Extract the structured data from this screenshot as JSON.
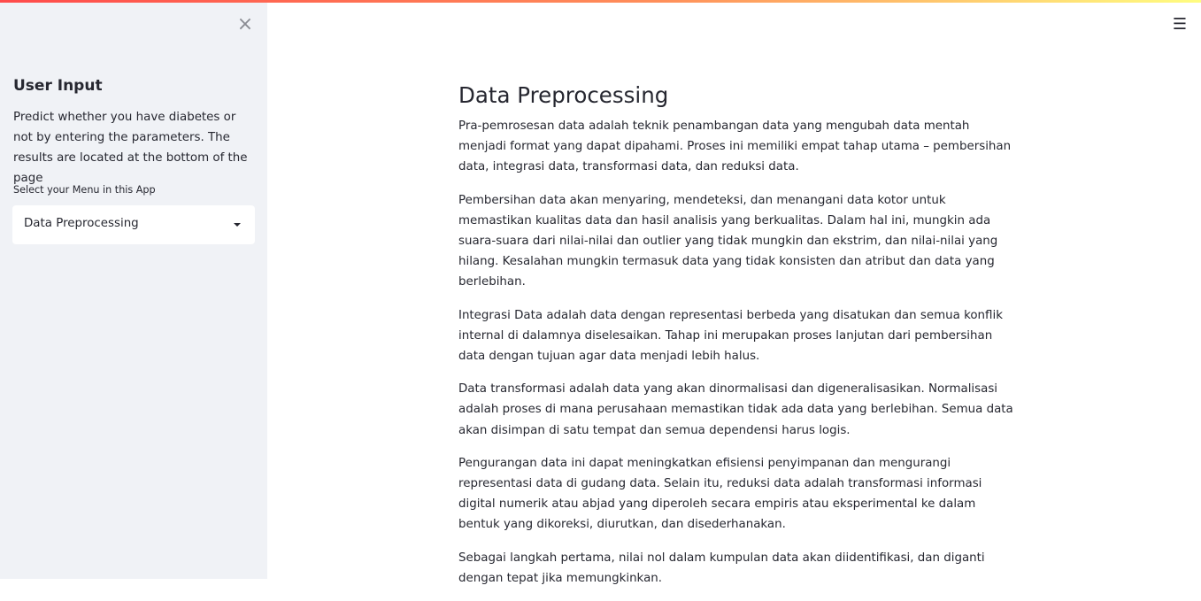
{
  "sidebar": {
    "close_icon": "×",
    "title": "User Input",
    "description": "Predict whether you have diabetes or not by entering the parameters. The results are located at the bottom of the page",
    "select_label": "Select your Menu in this App",
    "select_value": "Data Preprocessing"
  },
  "header": {
    "menu_icon": "☰"
  },
  "main": {
    "title": "Data Preprocessing",
    "paragraphs": [
      "Pra-pemrosesan data adalah teknik penambangan data yang mengubah data mentah menjadi format yang dapat dipahami. Proses ini memiliki empat tahap utama – pembersihan data, integrasi data, transformasi data, dan reduksi data.",
      "Pembersihan data akan menyaring, mendeteksi, dan menangani data kotor untuk memastikan kualitas data dan hasil analisis yang berkualitas. Dalam hal ini, mungkin ada suara-suara dari nilai-nilai dan outlier yang tidak mungkin dan ekstrim, dan nilai-nilai yang hilang. Kesalahan mungkin termasuk data yang tidak konsisten dan atribut dan data yang berlebihan.",
      "Integrasi Data adalah data dengan representasi berbeda yang disatukan dan semua konflik internal di dalamnya diselesaikan. Tahap ini merupakan proses lanjutan dari pembersihan data dengan tujuan agar data menjadi lebih halus.",
      "Data transformasi adalah data yang akan dinormalisasi dan digeneralisasikan. Normalisasi adalah proses di mana perusahaan memastikan tidak ada data yang berlebihan. Semua data akan disimpan di satu tempat dan semua dependensi harus logis.",
      "Pengurangan data ini dapat meningkatkan efisiensi penyimpanan dan mengurangi representasi data di gudang data. Selain itu, reduksi data adalah transformasi informasi digital numerik atau abjad yang diperoleh secara empiris atau eksperimental ke dalam bentuk yang dikoreksi, diurutkan, dan disederhanakan.",
      "Sebagai langkah pertama, nilai nol dalam kumpulan data akan diidentifikasi, dan diganti dengan tepat jika memungkinkan."
    ]
  },
  "colors": {
    "sidebar_bg": "#f0f2f6",
    "text": "#262730",
    "accent_start": "#ff4b4b",
    "accent_end": "#fffd80"
  }
}
